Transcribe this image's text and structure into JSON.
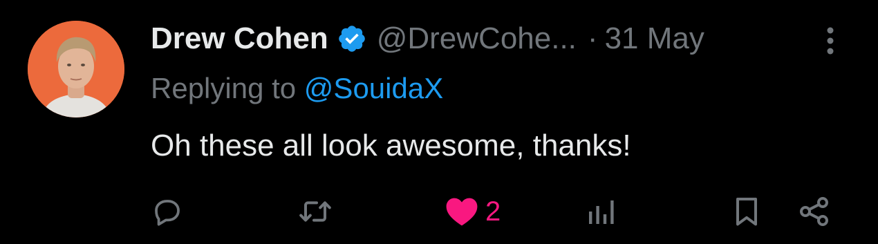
{
  "tweet": {
    "author": {
      "display_name": "Drew Cohen",
      "handle": "@DrewCohe...",
      "verified": true
    },
    "separator": "·",
    "time": "31 May",
    "replying_to_prefix": "Replying to",
    "replying_to_handle": "@SouidaX",
    "text": "Oh these all look awesome, thanks!",
    "actions": {
      "replies_icon": "reply-icon",
      "retweet_icon": "retweet-icon",
      "like_icon": "heart-filled-icon",
      "likes": "2",
      "views_icon": "views-icon",
      "bookmark_icon": "bookmark-icon",
      "share_icon": "share-icon"
    }
  },
  "colors": {
    "background": "#000000",
    "text_primary": "#e7e9ea",
    "text_secondary": "#71767b",
    "accent_blue": "#1d9bf0",
    "like_pink": "#f91880",
    "avatar_bg": "#ec6a3c"
  }
}
